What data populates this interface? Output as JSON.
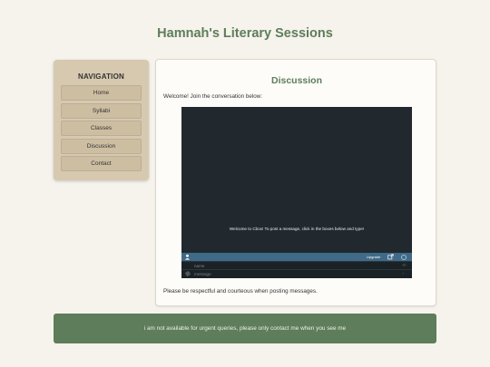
{
  "site": {
    "title": "Hamnah's Literary Sessions"
  },
  "nav": {
    "heading": "NAVIGATION",
    "items": [
      {
        "label": "Home"
      },
      {
        "label": "Syllabi"
      },
      {
        "label": "Classes"
      },
      {
        "label": "Discussion"
      },
      {
        "label": "Contact"
      }
    ]
  },
  "main": {
    "title": "Discussion",
    "welcome": "Welcome! Join the conversation below:",
    "note": "Please be respectful and courteous when posting messages."
  },
  "chat": {
    "welcome_message": "Welcome to Cbox! To post a message, click in the boxes below and type!",
    "upgrade_label": "Upgrade",
    "name_placeholder": "name",
    "name_aside": "+/-",
    "message_placeholder": "message",
    "message_aside": "↓",
    "icons": [
      "user-icon",
      "popout-icon",
      "help-icon",
      "gear-icon"
    ]
  },
  "footer": {
    "text": "i am not available for urgent queries, please only contact me when you see me"
  },
  "colors": {
    "background": "#f5f3ec",
    "accent_green": "#5e7d5a",
    "nav_bg": "#d7c9af",
    "chat_bg": "#21292e",
    "chat_toolbar": "#3f6a88"
  }
}
